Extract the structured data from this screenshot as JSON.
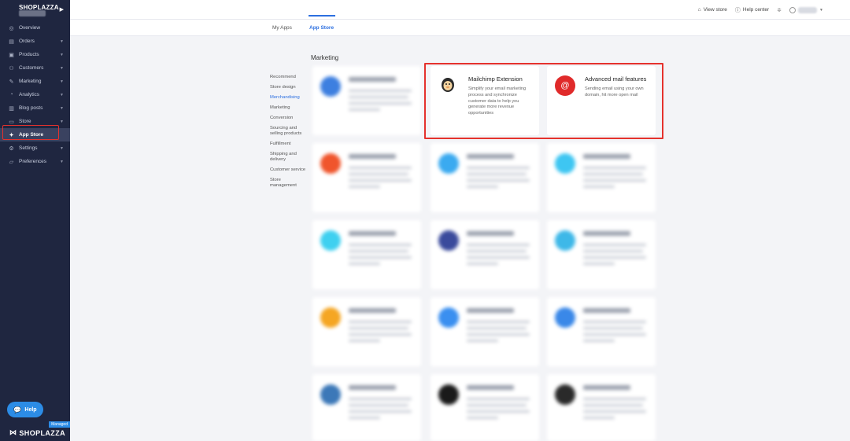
{
  "sidebar": {
    "brand": "SHOPLAZZA",
    "items": [
      {
        "label": "Overview",
        "icon": "overview-icon",
        "glyph": "◎"
      },
      {
        "label": "Orders",
        "icon": "orders-icon",
        "glyph": "▤"
      },
      {
        "label": "Products",
        "icon": "products-icon",
        "glyph": "▣"
      },
      {
        "label": "Customers",
        "icon": "customers-icon",
        "glyph": "⚇"
      },
      {
        "label": "Marketing",
        "icon": "marketing-icon",
        "glyph": "✎"
      },
      {
        "label": "Analytics",
        "icon": "analytics-icon",
        "glyph": "◔"
      },
      {
        "label": "Blog posts",
        "icon": "blog-icon",
        "glyph": "▥"
      },
      {
        "label": "Store",
        "icon": "store-icon",
        "glyph": "▭"
      },
      {
        "label": "App Store",
        "icon": "wrench-icon",
        "glyph": "✦"
      },
      {
        "label": "Settings",
        "icon": "settings-icon",
        "glyph": "⚙"
      },
      {
        "label": "Preferences",
        "icon": "preferences-icon",
        "glyph": "▱"
      }
    ],
    "help_label": "Help",
    "footer_brand": "SHOPLAZZA",
    "footer_badge": "Managed"
  },
  "topbar": {
    "view_store": "View store",
    "help_center": "Help center"
  },
  "tabs": {
    "my_apps": "My Apps",
    "app_store": "App Store"
  },
  "section_title": "Marketing",
  "categories": [
    "Recommend",
    "Store design",
    "Merchandising",
    "Marketing",
    "Conversion",
    "Sourcing and selling products",
    "Fulfillment",
    "Shipping and delivery",
    "Customer service",
    "Store management"
  ],
  "apps": {
    "mailchimp": {
      "title": "Mailchimp Extension",
      "desc": "Simplify your email marketing process and synchronize customer data to help you generate more revenue opportunities"
    },
    "advanced_mail": {
      "title": "Advanced mail features",
      "desc": "Sending email using your own domain, hit more open mail",
      "glyph": "@"
    }
  },
  "colors": {
    "accent": "#2c6fe0",
    "highlight": "#e5322d",
    "sidebar": "#1f2640",
    "help": "#2c8ce6"
  }
}
